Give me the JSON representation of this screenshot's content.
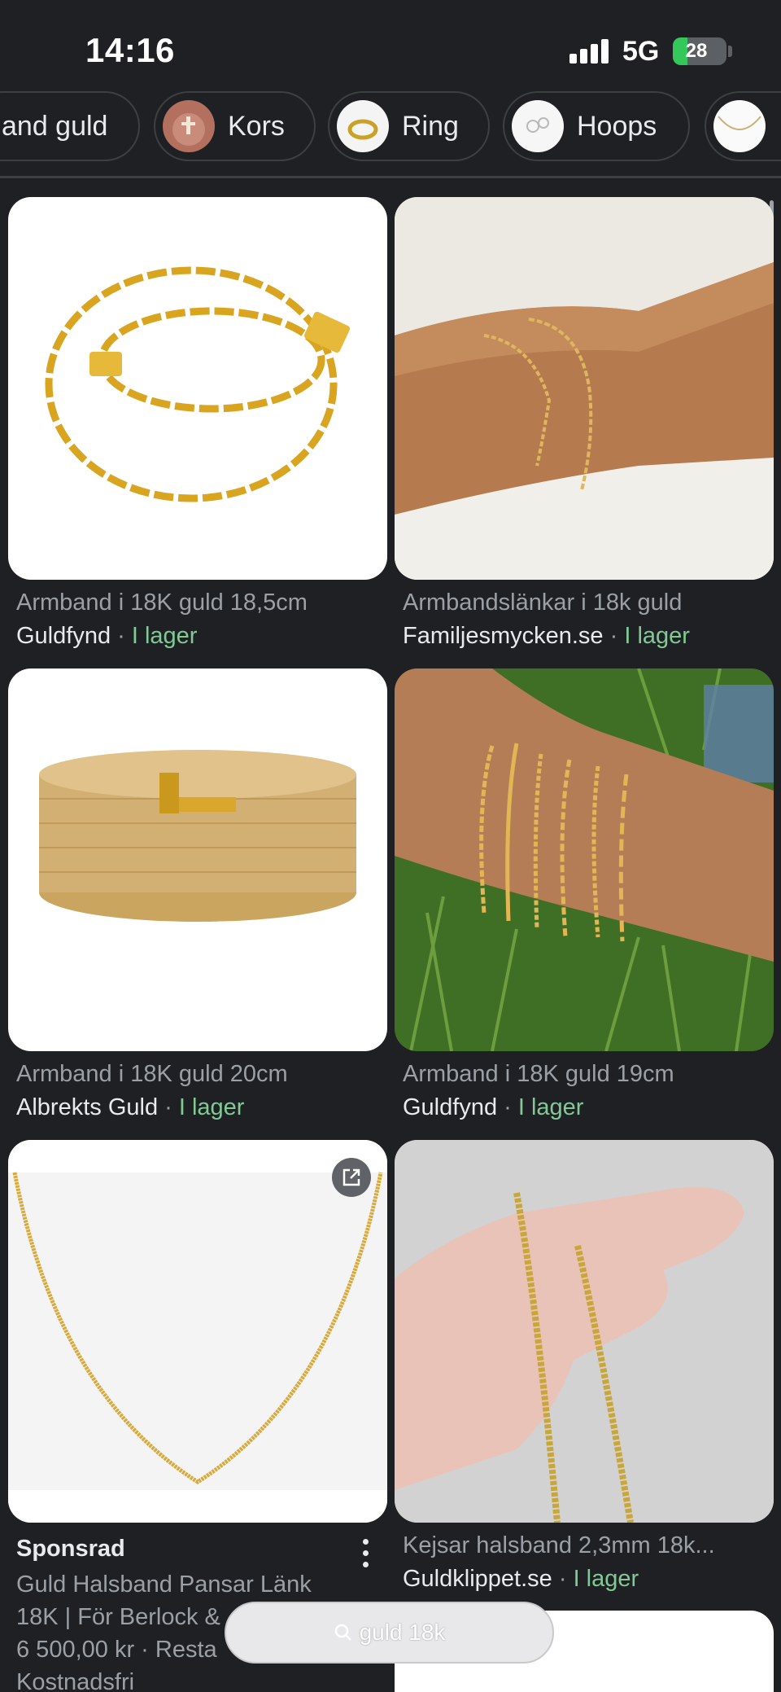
{
  "status_bar": {
    "time": "14:16",
    "network": "5G",
    "battery": "28",
    "battery_level": 0.28
  },
  "chips": [
    {
      "label": "and guld"
    },
    {
      "label": "Kors"
    },
    {
      "label": "Ring"
    },
    {
      "label": "Hoops"
    },
    {
      "label": ""
    }
  ],
  "results": [
    {
      "title": "Armband i 18K guld 18,5cm",
      "store": "Guldfynd",
      "separator": " · ",
      "stock": "I lager"
    },
    {
      "title": "Armbandslänkar i 18k guld",
      "store": "Familjesmycken.se",
      "separator": " · ",
      "stock": "I lager"
    },
    {
      "title": "Armband i 18K guld 20cm",
      "store": "Albrekts Guld",
      "separator": " · ",
      "stock": "I lager"
    },
    {
      "title": "Armband i 18K guld 19cm",
      "store": "Guldfynd",
      "separator": " · ",
      "stock": "I lager"
    },
    {
      "title": "Kejsar halsband 2,3mm 18k...",
      "store": "Guldklippet.se",
      "separator": " · ",
      "stock": "I lager"
    }
  ],
  "ad": {
    "sponsored_label": "Sponsrad",
    "title_line1": "Guld Halsband Pansar Länk",
    "title_line2": "18K | För Berlock &",
    "price_line": "6 500,00 kr · Resta",
    "shipping_line": "Kostnadsfri"
  },
  "search": {
    "query": "guld 18k"
  },
  "colors": {
    "background": "#1f2024",
    "stock_green": "#81c995",
    "muted_text": "#9aa0a6"
  }
}
